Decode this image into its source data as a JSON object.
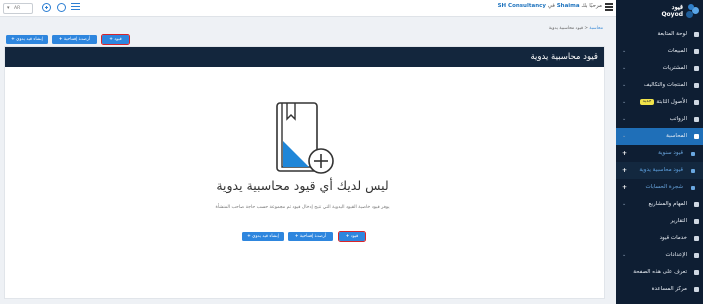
{
  "topbar": {
    "greeting_prefix": "مرحبًا بك",
    "user_name": "Shaima",
    "greeting_in": "في",
    "company": "SH Consultancy",
    "lang_value": "AR"
  },
  "sidebar": {
    "logo_arabic": "قيود",
    "logo_latin": "Qoyod",
    "items": [
      {
        "label": "لوحة المتابعة",
        "icon": "dashboard-icon",
        "chevron": false
      },
      {
        "label": "المبيعات",
        "icon": "dollar-icon",
        "chevron": true
      },
      {
        "label": "المشتريات",
        "icon": "cart-icon",
        "chevron": true
      },
      {
        "label": "المنتجات والتكاليف",
        "icon": "grid-icon",
        "chevron": true
      },
      {
        "label": "الأصول الثابتة",
        "badge": "جديد",
        "icon": "grid-icon",
        "chevron": true
      },
      {
        "label": "الرواتب",
        "icon": "folder-icon",
        "chevron": true
      },
      {
        "label": "المحاسبة",
        "icon": "folder-icon",
        "chevron": true,
        "active": true
      },
      {
        "label": "قيود سنوية",
        "icon": "doc-icon",
        "sub": true,
        "plus": true
      },
      {
        "label": "قيود محاسبية يدوية",
        "icon": "doc-icon",
        "sub": true,
        "plus": true,
        "current": true
      },
      {
        "label": "شجرة الحسابات",
        "icon": "chart-icon",
        "sub": true,
        "plus": true
      },
      {
        "label": "المهام والمشاريع",
        "icon": "grid-icon",
        "chevron": true
      },
      {
        "label": "التقارير",
        "icon": "report-icon",
        "chevron": false
      },
      {
        "label": "خدمات قيود",
        "icon": "services-icon",
        "chevron": false
      },
      {
        "label": "الإعدادات",
        "icon": "gear-icon",
        "chevron": true
      },
      {
        "label": "تعرف على هذه الصفحة",
        "icon": "help-icon",
        "chevron": false
      },
      {
        "label": "مركز المساعدة",
        "icon": "book-icon",
        "chevron": false
      }
    ]
  },
  "buttons": {
    "create": "قيود",
    "add_open": "أرصدة إفتتاحية",
    "create_manual": "إنشاء قيد يدوي"
  },
  "breadcrumb": {
    "parent": "محاسبة",
    "current": "قيود محاسبية يدوية"
  },
  "panel": {
    "title": "قيود محاسبية يدوية",
    "empty_title": "ليس لديك أي قيود محاسبية يدوية",
    "empty_desc": "يوفر قيود خاصية القيود اليدوية التي تتيح إدخال قيود ثم مجموعة حسب حاجة صاحب المنشأة"
  }
}
